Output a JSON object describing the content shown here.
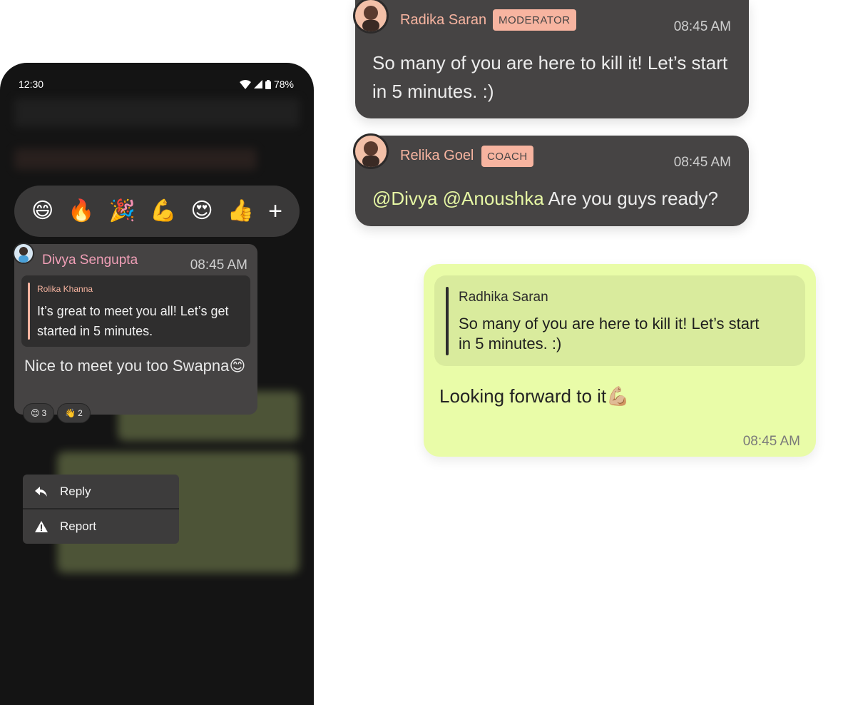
{
  "phone": {
    "status": {
      "time": "12:30",
      "battery": "78%"
    },
    "reaction_bar": {
      "emojis": [
        "😄",
        "🔥",
        "🎉",
        "💪",
        "😍",
        "👍"
      ],
      "add": "+"
    },
    "message": {
      "sender": "Divya Sengupta",
      "time": "08:45 AM",
      "quote": {
        "sender": "Rolika Khanna",
        "text": "It’s great to meet you all! Let’s get started in 5 minutes."
      },
      "body": "Nice to meet you too Swapna😊",
      "reactions": [
        {
          "emoji": "😊",
          "count": "3"
        },
        {
          "emoji": "👋",
          "count": "2"
        }
      ]
    },
    "menu": {
      "reply": "Reply",
      "report": "Report"
    }
  },
  "cards": [
    {
      "sender": "Radika Saran",
      "badge": "MODERATOR",
      "time": "08:45 AM",
      "text": "So many of you are here to kill it! Let’s start in 5 minutes. :)"
    },
    {
      "sender": "Relika Goel",
      "badge": "COACH",
      "time": "08:45 AM",
      "mention": "@Divya @Anoushka",
      "text": " Are you guys ready?"
    }
  ],
  "my_message": {
    "quote": {
      "sender": "Radhika Saran",
      "text": "So many of you are here to kill it! Let’s start in 5 minutes. :)"
    },
    "body": "Looking forward to it💪🏼",
    "time": "08:45 AM"
  },
  "colors": {
    "phone_bg": "#141414",
    "card_bg": "#464444",
    "accent_pink": "#f09fb7",
    "accent_peach": "#f7b4a0",
    "mention": "#e6f7a4",
    "my_bubble": "#e9fca8"
  }
}
